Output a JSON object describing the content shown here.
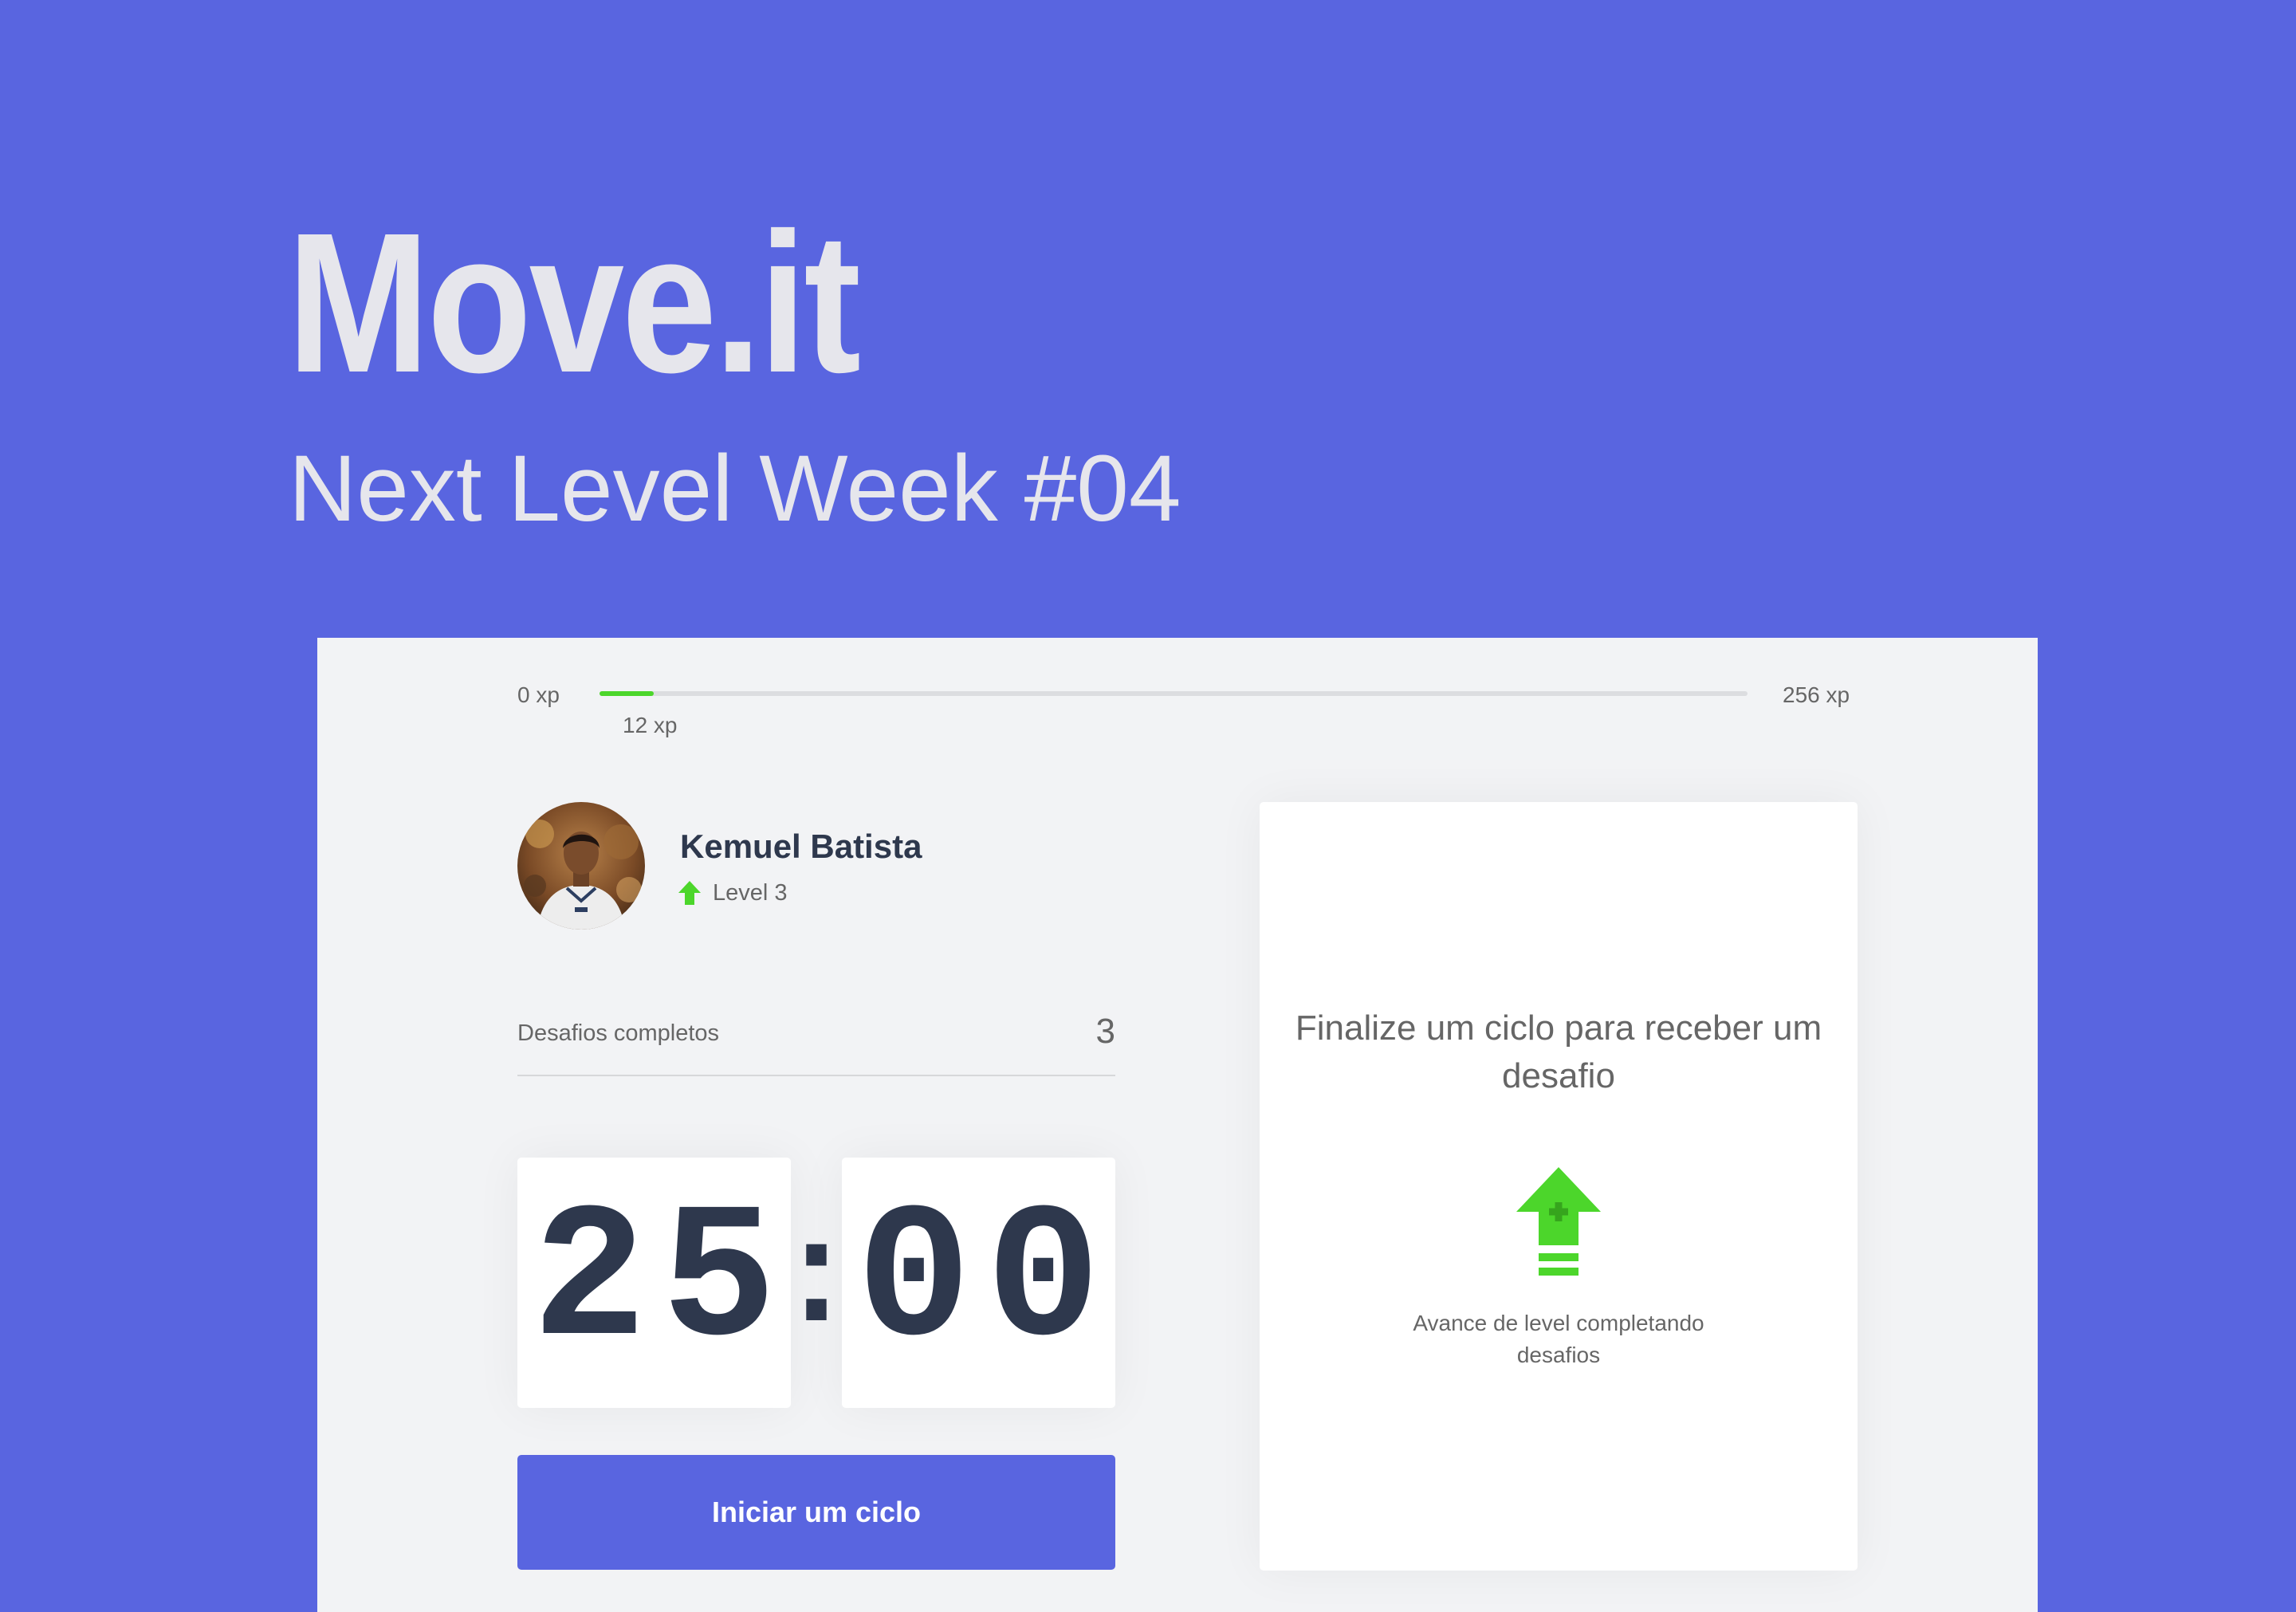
{
  "hero": {
    "title": "Move.it",
    "subtitle": "Next Level Week #04"
  },
  "colors": {
    "background": "#5965E0",
    "app_background": "#F2F3F5",
    "accent_green": "#4CD62B",
    "text_dark": "#2E384D",
    "text_muted": "#666666"
  },
  "experience_bar": {
    "min_label": "0 xp",
    "max_label": "256 xp",
    "current_label": "12 xp",
    "current_xp": 12,
    "max_xp": 256
  },
  "profile": {
    "name": "Kemuel Batista",
    "level_label": "Level 3",
    "level_icon": "level-up-arrow-icon",
    "avatar": "user-photo"
  },
  "completed_challenges": {
    "label": "Desafios completos",
    "value": "3"
  },
  "countdown": {
    "minutes_tens": "2",
    "minutes_ones": "5",
    "separator": ":",
    "seconds_tens": "0",
    "seconds_ones": "0"
  },
  "start_button": {
    "label": "Iniciar um ciclo"
  },
  "challenge_box": {
    "title": "Finalize um ciclo para receber um desafio",
    "icon": "level-up-icon",
    "hint": "Avance de level completando desafios"
  }
}
